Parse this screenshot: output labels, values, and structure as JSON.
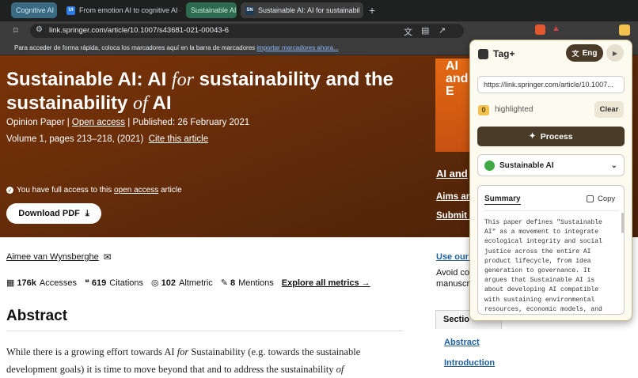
{
  "browser": {
    "tabs": [
      {
        "label": "Cognitive AI",
        "kind": "group"
      },
      {
        "label": "From emotion AI to cognitive AI - Co",
        "kind": "tab",
        "favicon": "UI"
      },
      {
        "label": "Sustainable AI",
        "kind": "group"
      },
      {
        "label": "Sustainable AI: AI for sustainabil",
        "kind": "tab",
        "favicon": "SN"
      }
    ],
    "url": "link.springer.com/article/10.1007/s43681-021-00043-6",
    "bookmarks_text": "Para acceder de forma rápida, coloca los marcadores aquí en la barra de marcadores",
    "bookmarks_link": "importar marcadores ahora..."
  },
  "article": {
    "title_part1": "Sustainable AI: AI ",
    "title_for": "for",
    "title_part2": " sustainability and the sustainability ",
    "title_of": "of",
    "title_part3": " AI",
    "type": "Opinion Paper",
    "access": "Open access",
    "published": "Published: 26 February 2021",
    "volume": "Volume 1, pages 213–218, (2021)",
    "cite": "Cite this article",
    "access_note_pre": "You have full access to this ",
    "access_note_link": "open access",
    "access_note_post": " article",
    "download": "Download PDF",
    "author": "Aimee van Wynsberghe",
    "metrics": {
      "accesses_value": "176k",
      "accesses_label": "Accesses",
      "citations_value": "619",
      "citations_label": "Citations",
      "altmetric_value": "102",
      "altmetric_label": "Altmetric",
      "mentions_value": "8",
      "mentions_label": "Mentions",
      "explore": "Explore all metrics"
    },
    "abstract_heading": "Abstract",
    "abstract_line1_pre": "While there is a growing effort towards AI ",
    "abstract_line1_for": "for",
    "abstract_line1_post": " Sustainability (e.g. towards the sustainable",
    "abstract_line2_pre": "development goals) it is time to move beyond that and to address the sustainability ",
    "abstract_line2_of": "of"
  },
  "sidebar": {
    "cover_text": "AI and E",
    "journal_link1": "AI and",
    "journal_link2": "Aims and",
    "journal_link3": "Submit m",
    "use_our": "Use our p",
    "avoid1": "Avoid co",
    "avoid2": "manuscr",
    "sections_tab": "Sectio",
    "toc": [
      "Abstract",
      "Introduction"
    ]
  },
  "extension": {
    "name": "Tag+",
    "language": "Eng",
    "url_field": "https://link.springer.com/article/10.1007...",
    "highlight_count": "0",
    "highlighted_label": "highlighted",
    "clear": "Clear",
    "process": "Process",
    "selected_tag": "Sustainable AI",
    "summary_tab": "Summary",
    "copy": "Copy",
    "summary_text": "This paper defines \"Sustainable AI\" as a movement to integrate ecological integrity and social justice across the entire AI product lifecycle, from idea generation to governance. It argues that Sustainable AI is about developing AI compatible with sustaining environmental resources, economic models, and societal values for future generations.",
    "colors": {
      "accent": "#4a3b28",
      "highlight": "#f2c14e",
      "tag": "#3faa45"
    }
  }
}
